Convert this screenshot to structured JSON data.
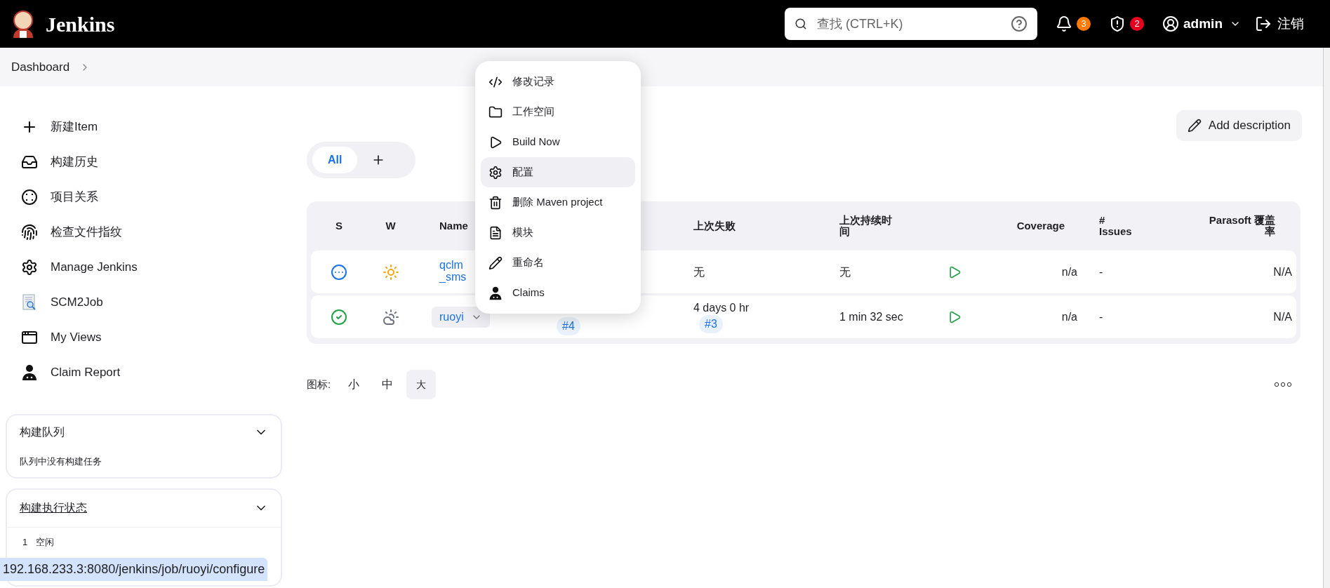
{
  "header": {
    "logo_text": "Jenkins",
    "search": {
      "placeholder": "查找 (CTRL+K)"
    },
    "notifications": "3",
    "security": "2",
    "user": "admin",
    "logout": "注销"
  },
  "breadcrumb": [
    {
      "label": "Dashboard"
    }
  ],
  "sidebar": {
    "items": [
      {
        "label": "新建Item",
        "kind": "plus"
      },
      {
        "label": "构建历史",
        "kind": "inbox"
      },
      {
        "label": "项目关系",
        "kind": "relations"
      },
      {
        "label": "检查文件指纹",
        "kind": "fingerprint"
      },
      {
        "label": "Manage Jenkins",
        "kind": "gear"
      },
      {
        "label": "SCM2Job",
        "kind": "scm"
      },
      {
        "label": "My Views",
        "kind": "window"
      },
      {
        "label": "Claim Report",
        "kind": "person"
      }
    ]
  },
  "build_queue": {
    "title": "构建队列",
    "expanded": true,
    "message": "队列中没有构建任务"
  },
  "executor_status": {
    "title": "构建执行状态",
    "expanded": true,
    "executors": [
      {
        "number": "1",
        "state": "空闲"
      }
    ]
  },
  "add_description": "Add description",
  "view_tabs": [
    {
      "label": "All",
      "selected": true
    }
  ],
  "table": {
    "columns": [
      "S",
      "W",
      "Name",
      "上次失败",
      "上次持续时间",
      "Coverage",
      "# Issues",
      "Parasoft 覆盖率"
    ],
    "rows": [
      {
        "status": {
          "kind": "pending"
        },
        "weather": {
          "kind": "sunny"
        },
        "name": "qclm_sms",
        "menu_open": false,
        "last_failure": "无",
        "duration": "无",
        "coverage": "n/a",
        "issues": "-",
        "parasoft": "N/A"
      },
      {
        "status": {
          "kind": "success"
        },
        "weather": {
          "kind": "cloudy"
        },
        "name": "ruoyi",
        "menu_open": true,
        "last_success_build": "#4",
        "last_failure": "4 days 0 hr",
        "last_failure_build": "#3",
        "duration": "1 min 32 sec",
        "coverage": "n/a",
        "issues": "-",
        "parasoft": "N/A"
      }
    ]
  },
  "context_menu": {
    "items": [
      {
        "label": "修改记录",
        "kind": "code",
        "selected": false
      },
      {
        "label": "工作空间",
        "kind": "folder",
        "selected": false
      },
      {
        "label": "Build Now",
        "kind": "play",
        "selected": false
      },
      {
        "label": "配置",
        "kind": "gear",
        "selected": true
      },
      {
        "label": "删除 Maven project",
        "kind": "trash",
        "selected": false
      },
      {
        "label": "模块",
        "kind": "file",
        "selected": false
      },
      {
        "label": "重命名",
        "kind": "pencil",
        "selected": false
      },
      {
        "label": "Claims",
        "kind": "person",
        "selected": false
      }
    ]
  },
  "icon_size": {
    "label": "图标:",
    "sizes": [
      {
        "label": "小",
        "selected": false
      },
      {
        "label": "中",
        "selected": false
      },
      {
        "label": "大",
        "selected": true
      }
    ]
  },
  "status_bar": {
    "url": "192.168.233.3:8080/jenkins/job/ruoyi/configure"
  }
}
